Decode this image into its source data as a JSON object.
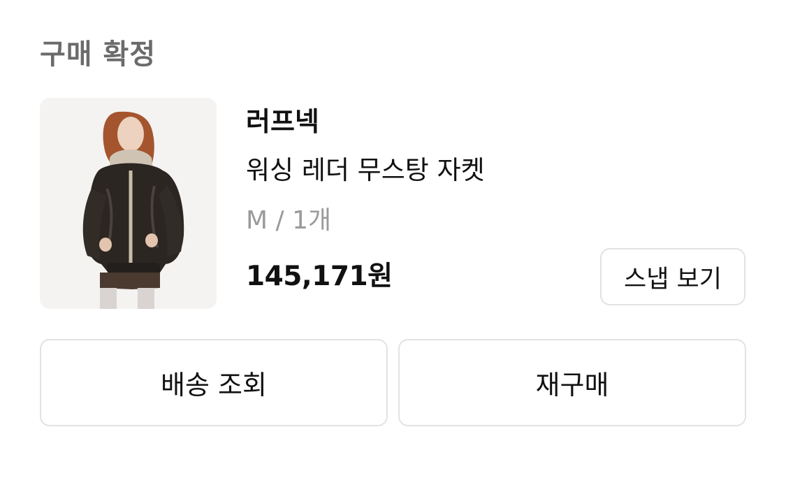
{
  "order": {
    "status": "구매 확정"
  },
  "product": {
    "brand": "러프넥",
    "name": "워싱 레더 무스탕 자켓",
    "option": "M / 1개",
    "price": "145,171원",
    "image_alt": "워싱 레더 무스탕 자켓"
  },
  "actions": {
    "snap_label": "스냅 보기",
    "tracking_label": "배송 조회",
    "rebuy_label": "재구매"
  }
}
